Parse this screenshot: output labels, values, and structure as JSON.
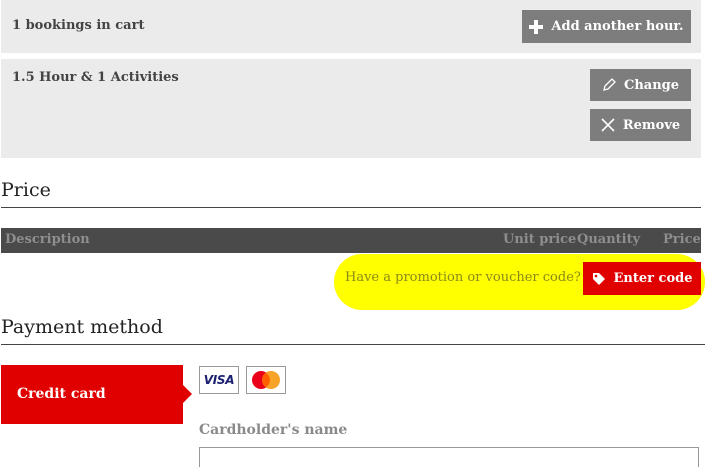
{
  "cart": {
    "count_text": "1 bookings in cart",
    "add_button": "Add another hour."
  },
  "item": {
    "title": "1.5 Hour & 1 Activities",
    "change_button": "Change",
    "remove_button": "Remove"
  },
  "price": {
    "heading": "Price",
    "columns": [
      "Description",
      "Unit price",
      "Quantity",
      "Price"
    ]
  },
  "promo": {
    "prompt": "Have a promotion or voucher code?",
    "button": "Enter code"
  },
  "payment": {
    "heading": "Payment method",
    "method_tab": "Credit card",
    "cards": [
      {
        "name": "VISA",
        "icon": "visa-logo"
      },
      {
        "name": "Mastercard",
        "icon": "mastercard-logo"
      }
    ],
    "cardholder_label": "Cardholder's name",
    "cardholder_value": ""
  },
  "colors": {
    "accent_red": "#e00000",
    "button_grey": "#7d7d7d",
    "highlight": "#ffff00"
  }
}
